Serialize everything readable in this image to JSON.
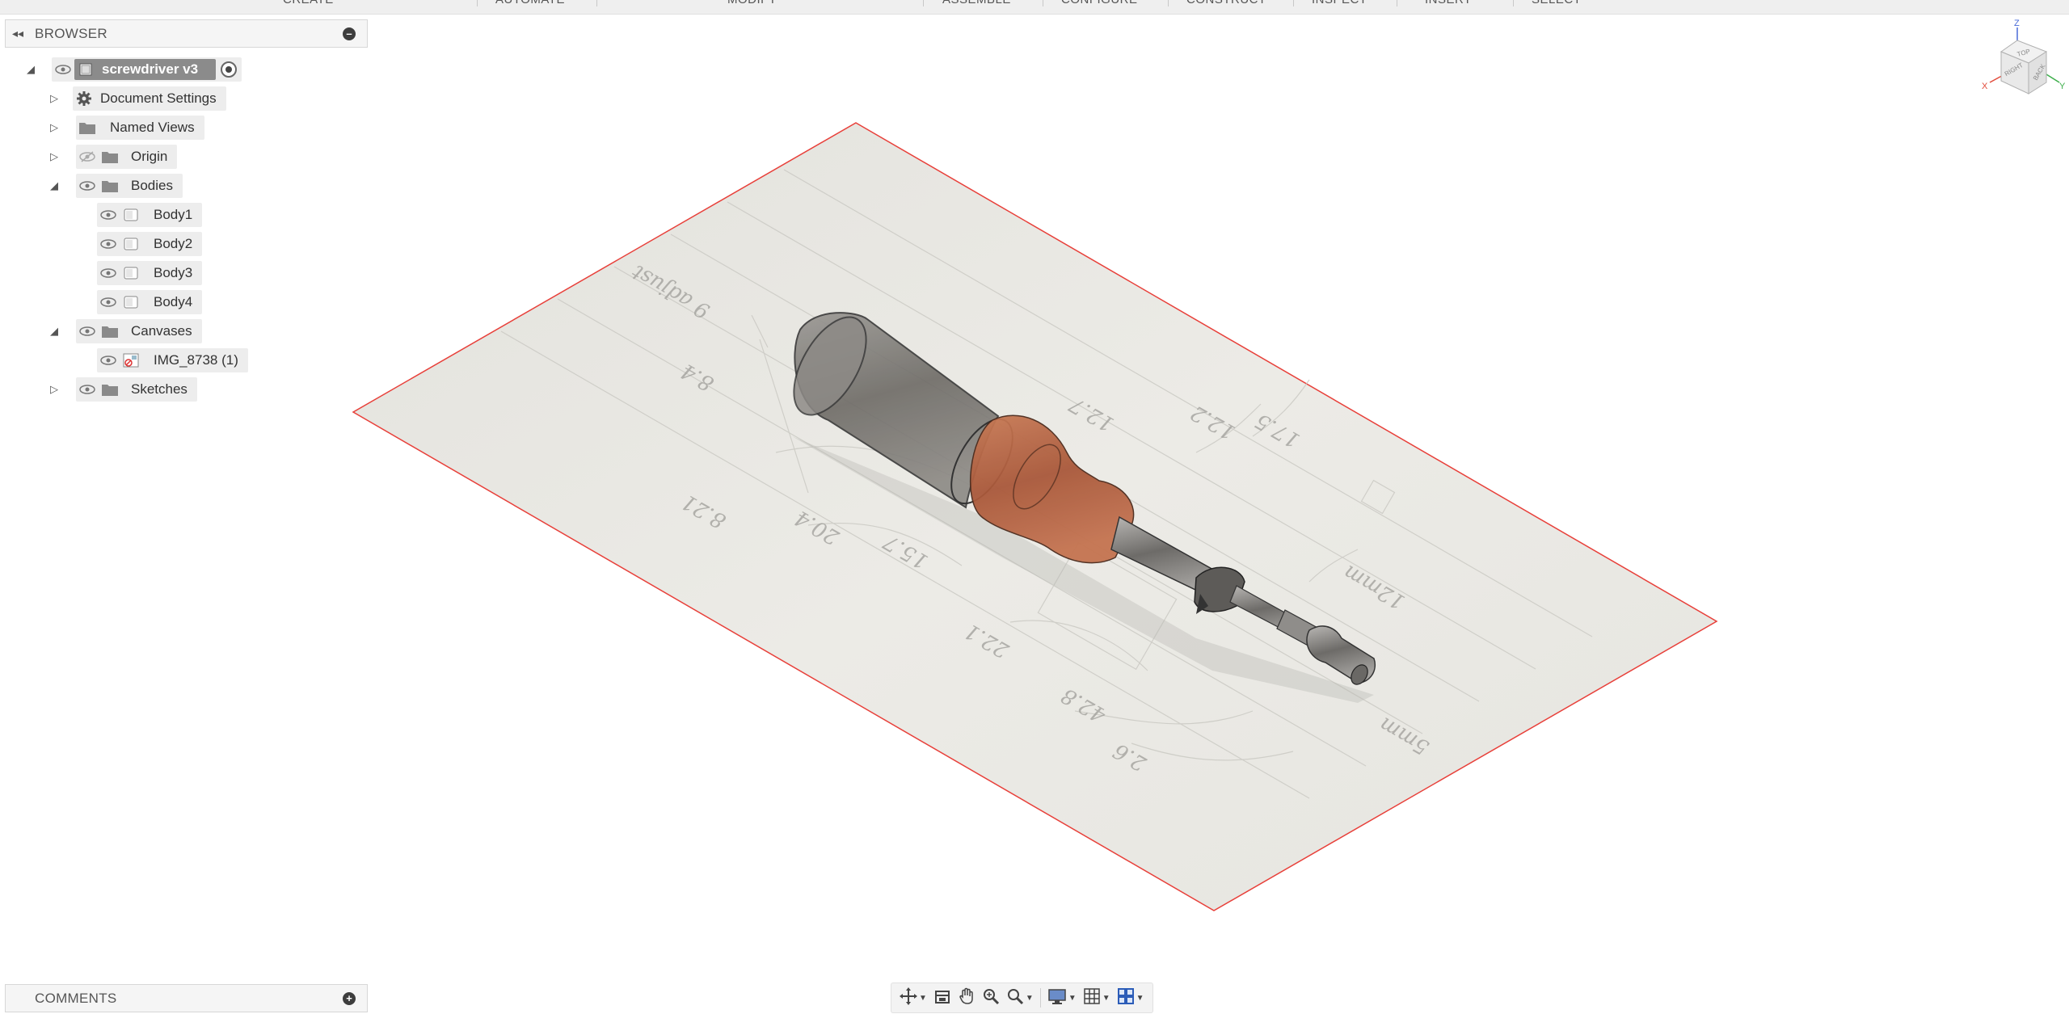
{
  "toolbar": {
    "groups": [
      "CREATE",
      "AUTOMATE",
      "MODIFY",
      "ASSEMBLE",
      "CONFIGURE",
      "CONSTRUCT",
      "INSPECT",
      "INSERT",
      "SELECT"
    ]
  },
  "browser": {
    "title": "BROWSER",
    "root": {
      "label": "screwdriver v3"
    },
    "items": {
      "document_settings": "Document Settings",
      "named_views": "Named Views",
      "origin": "Origin",
      "bodies": "Bodies",
      "body1": "Body1",
      "body2": "Body2",
      "body3": "Body3",
      "body4": "Body4",
      "canvases": "Canvases",
      "canvas_img": "IMG_8738 (1)",
      "sketches": "Sketches"
    }
  },
  "comments": {
    "title": "COMMENTS"
  },
  "viewcube": {
    "top": "TOP",
    "right": "RIGHT",
    "back": "BACK",
    "axes": {
      "z": "Z",
      "x": "X",
      "y": "Y"
    }
  },
  "colors": {
    "accent_edge": "#e8403a",
    "body_gray": "#7a7a7a",
    "body_copper": "#b5643f",
    "panel_bg": "#f5f5f5"
  },
  "navbar": {
    "tools": [
      "orbit-icon",
      "look-at-icon",
      "pan-icon",
      "zoom-icon",
      "zoom-window-icon",
      "display-settings-icon",
      "grid-settings-icon",
      "viewports-icon"
    ]
  }
}
